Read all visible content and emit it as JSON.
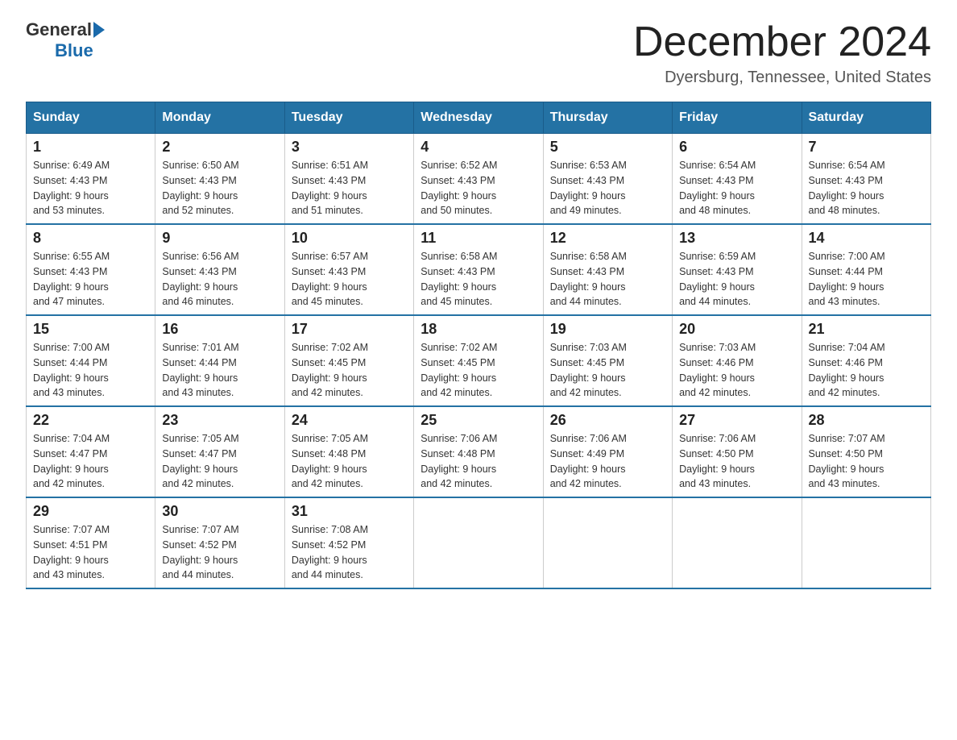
{
  "header": {
    "logo_general": "General",
    "logo_blue": "Blue",
    "month_title": "December 2024",
    "location": "Dyersburg, Tennessee, United States"
  },
  "weekdays": [
    "Sunday",
    "Monday",
    "Tuesday",
    "Wednesday",
    "Thursday",
    "Friday",
    "Saturday"
  ],
  "weeks": [
    [
      {
        "day": "1",
        "sunrise": "6:49 AM",
        "sunset": "4:43 PM",
        "daylight": "9 hours and 53 minutes."
      },
      {
        "day": "2",
        "sunrise": "6:50 AM",
        "sunset": "4:43 PM",
        "daylight": "9 hours and 52 minutes."
      },
      {
        "day": "3",
        "sunrise": "6:51 AM",
        "sunset": "4:43 PM",
        "daylight": "9 hours and 51 minutes."
      },
      {
        "day": "4",
        "sunrise": "6:52 AM",
        "sunset": "4:43 PM",
        "daylight": "9 hours and 50 minutes."
      },
      {
        "day": "5",
        "sunrise": "6:53 AM",
        "sunset": "4:43 PM",
        "daylight": "9 hours and 49 minutes."
      },
      {
        "day": "6",
        "sunrise": "6:54 AM",
        "sunset": "4:43 PM",
        "daylight": "9 hours and 48 minutes."
      },
      {
        "day": "7",
        "sunrise": "6:54 AM",
        "sunset": "4:43 PM",
        "daylight": "9 hours and 48 minutes."
      }
    ],
    [
      {
        "day": "8",
        "sunrise": "6:55 AM",
        "sunset": "4:43 PM",
        "daylight": "9 hours and 47 minutes."
      },
      {
        "day": "9",
        "sunrise": "6:56 AM",
        "sunset": "4:43 PM",
        "daylight": "9 hours and 46 minutes."
      },
      {
        "day": "10",
        "sunrise": "6:57 AM",
        "sunset": "4:43 PM",
        "daylight": "9 hours and 45 minutes."
      },
      {
        "day": "11",
        "sunrise": "6:58 AM",
        "sunset": "4:43 PM",
        "daylight": "9 hours and 45 minutes."
      },
      {
        "day": "12",
        "sunrise": "6:58 AM",
        "sunset": "4:43 PM",
        "daylight": "9 hours and 44 minutes."
      },
      {
        "day": "13",
        "sunrise": "6:59 AM",
        "sunset": "4:43 PM",
        "daylight": "9 hours and 44 minutes."
      },
      {
        "day": "14",
        "sunrise": "7:00 AM",
        "sunset": "4:44 PM",
        "daylight": "9 hours and 43 minutes."
      }
    ],
    [
      {
        "day": "15",
        "sunrise": "7:00 AM",
        "sunset": "4:44 PM",
        "daylight": "9 hours and 43 minutes."
      },
      {
        "day": "16",
        "sunrise": "7:01 AM",
        "sunset": "4:44 PM",
        "daylight": "9 hours and 43 minutes."
      },
      {
        "day": "17",
        "sunrise": "7:02 AM",
        "sunset": "4:45 PM",
        "daylight": "9 hours and 42 minutes."
      },
      {
        "day": "18",
        "sunrise": "7:02 AM",
        "sunset": "4:45 PM",
        "daylight": "9 hours and 42 minutes."
      },
      {
        "day": "19",
        "sunrise": "7:03 AM",
        "sunset": "4:45 PM",
        "daylight": "9 hours and 42 minutes."
      },
      {
        "day": "20",
        "sunrise": "7:03 AM",
        "sunset": "4:46 PM",
        "daylight": "9 hours and 42 minutes."
      },
      {
        "day": "21",
        "sunrise": "7:04 AM",
        "sunset": "4:46 PM",
        "daylight": "9 hours and 42 minutes."
      }
    ],
    [
      {
        "day": "22",
        "sunrise": "7:04 AM",
        "sunset": "4:47 PM",
        "daylight": "9 hours and 42 minutes."
      },
      {
        "day": "23",
        "sunrise": "7:05 AM",
        "sunset": "4:47 PM",
        "daylight": "9 hours and 42 minutes."
      },
      {
        "day": "24",
        "sunrise": "7:05 AM",
        "sunset": "4:48 PM",
        "daylight": "9 hours and 42 minutes."
      },
      {
        "day": "25",
        "sunrise": "7:06 AM",
        "sunset": "4:48 PM",
        "daylight": "9 hours and 42 minutes."
      },
      {
        "day": "26",
        "sunrise": "7:06 AM",
        "sunset": "4:49 PM",
        "daylight": "9 hours and 42 minutes."
      },
      {
        "day": "27",
        "sunrise": "7:06 AM",
        "sunset": "4:50 PM",
        "daylight": "9 hours and 43 minutes."
      },
      {
        "day": "28",
        "sunrise": "7:07 AM",
        "sunset": "4:50 PM",
        "daylight": "9 hours and 43 minutes."
      }
    ],
    [
      {
        "day": "29",
        "sunrise": "7:07 AM",
        "sunset": "4:51 PM",
        "daylight": "9 hours and 43 minutes."
      },
      {
        "day": "30",
        "sunrise": "7:07 AM",
        "sunset": "4:52 PM",
        "daylight": "9 hours and 44 minutes."
      },
      {
        "day": "31",
        "sunrise": "7:08 AM",
        "sunset": "4:52 PM",
        "daylight": "9 hours and 44 minutes."
      },
      null,
      null,
      null,
      null
    ]
  ],
  "labels": {
    "sunrise": "Sunrise:",
    "sunset": "Sunset:",
    "daylight": "Daylight:"
  }
}
